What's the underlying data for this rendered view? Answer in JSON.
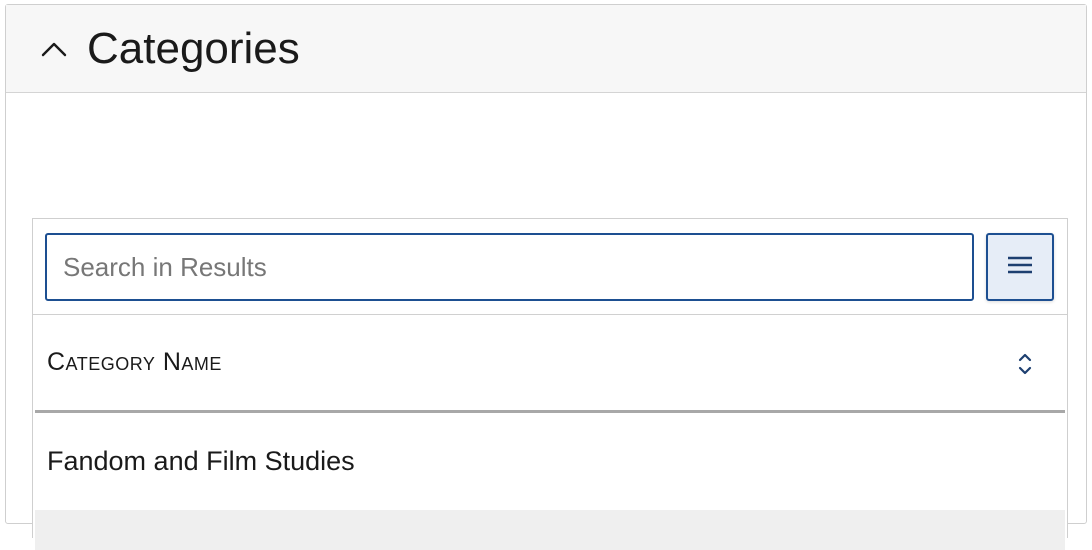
{
  "panel": {
    "title": "Categories",
    "toggle_icon": "chevron-up-icon"
  },
  "search": {
    "placeholder": "Search in Results",
    "value": ""
  },
  "toolbar": {
    "menu_icon": "hamburger-menu-icon"
  },
  "table": {
    "columns": [
      {
        "label": "Category Name",
        "sort_icon": "sort-toggle-icon"
      }
    ],
    "rows": [
      {
        "category_name": "Fandom and Film Studies"
      }
    ]
  },
  "colors": {
    "accent": "#1d4f91",
    "header_bg": "#f7f7f7",
    "button_bg": "#e6edf7"
  }
}
